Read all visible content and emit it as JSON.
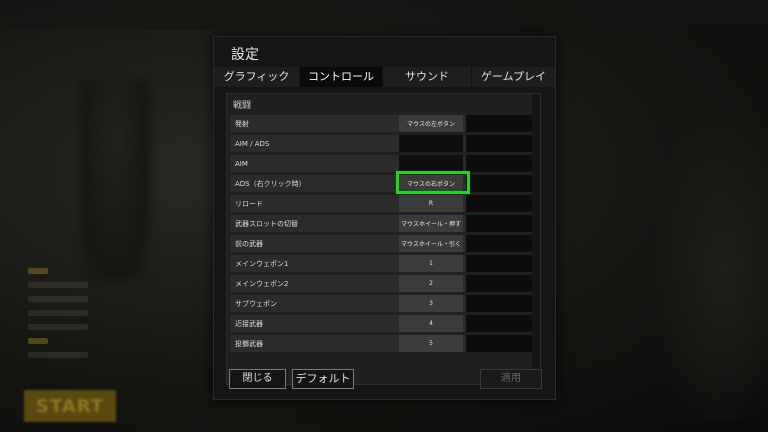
{
  "background": {
    "start_label": "START"
  },
  "dialog": {
    "title": "設定",
    "tabs": [
      {
        "label": "グラフィック",
        "active": false
      },
      {
        "label": "コントロール",
        "active": true
      },
      {
        "label": "サウンド",
        "active": false
      },
      {
        "label": "ゲームプレイ",
        "active": false
      }
    ],
    "section_label": "戦闘",
    "rows": [
      {
        "label": "発射",
        "key1": "マウスの左ボタン",
        "key2": ""
      },
      {
        "label": "AIM / ADS",
        "key1": "",
        "key2": ""
      },
      {
        "label": "AIM",
        "key1": "",
        "key2": ""
      },
      {
        "label": "ADS（右クリック時）",
        "key1": "マウスの右ボタン",
        "key2": ""
      },
      {
        "label": "リロード",
        "key1": "R",
        "key2": ""
      },
      {
        "label": "武器スロットの切替",
        "key1": "マウスホイール・押す",
        "key2": ""
      },
      {
        "label": "前の武器",
        "key1": "マウスホイール・引く",
        "key2": ""
      },
      {
        "label": "メインウェポン1",
        "key1": "1",
        "key2": ""
      },
      {
        "label": "メインウェポン2",
        "key1": "2",
        "key2": ""
      },
      {
        "label": "サブウェポン",
        "key1": "3",
        "key2": ""
      },
      {
        "label": "近接武器",
        "key1": "4",
        "key2": ""
      },
      {
        "label": "投擲武器",
        "key1": "5",
        "key2": ""
      }
    ],
    "buttons": {
      "close": "閉じる",
      "default": "デフォルト",
      "apply": "適用"
    }
  },
  "colors": {
    "highlight": "#1ed71e"
  }
}
